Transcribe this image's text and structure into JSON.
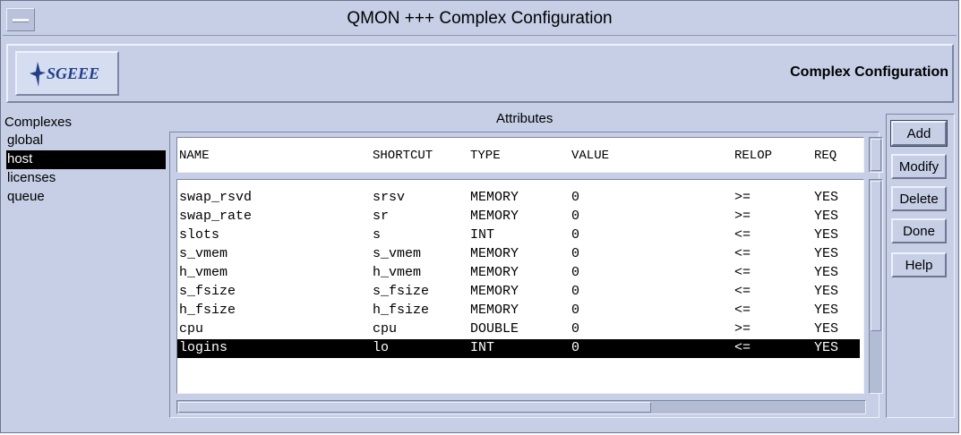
{
  "window": {
    "title": "QMON +++ Complex Configuration"
  },
  "header": {
    "logo_text": "SGEEE",
    "title": "Complex Configuration"
  },
  "complexes": {
    "label": "Complexes",
    "items": [
      {
        "label": "global",
        "selected": false
      },
      {
        "label": "host",
        "selected": true
      },
      {
        "label": "licenses",
        "selected": false
      },
      {
        "label": "queue",
        "selected": false
      }
    ]
  },
  "attributes": {
    "label": "Attributes",
    "columns": [
      "NAME",
      "SHORTCUT",
      "TYPE",
      "VALUE",
      "RELOP",
      "REQ"
    ],
    "rows": [
      [
        "swap_rsvd",
        "srsv",
        "MEMORY",
        "0",
        ">=",
        "YES"
      ],
      [
        "swap_rate",
        "sr",
        "MEMORY",
        "0",
        ">=",
        "YES"
      ],
      [
        "slots",
        "s",
        "INT",
        "0",
        "<=",
        "YES"
      ],
      [
        "s_vmem",
        "s_vmem",
        "MEMORY",
        "0",
        "<=",
        "YES"
      ],
      [
        "h_vmem",
        "h_vmem",
        "MEMORY",
        "0",
        "<=",
        "YES"
      ],
      [
        "s_fsize",
        "s_fsize",
        "MEMORY",
        "0",
        "<=",
        "YES"
      ],
      [
        "h_fsize",
        "h_fsize",
        "MEMORY",
        "0",
        "<=",
        "YES"
      ],
      [
        "cpu",
        "cpu",
        "DOUBLE",
        "0",
        ">=",
        "YES"
      ],
      [
        "logins",
        "lo",
        "INT",
        "0",
        "<=",
        "YES"
      ]
    ],
    "selected_row": 8
  },
  "buttons": {
    "add": "Add",
    "modify": "Modify",
    "delete": "Delete",
    "done": "Done",
    "help": "Help"
  },
  "colors": {
    "background": "#c6cfe6",
    "selection": "#000000",
    "logo_text": "#22408a"
  }
}
